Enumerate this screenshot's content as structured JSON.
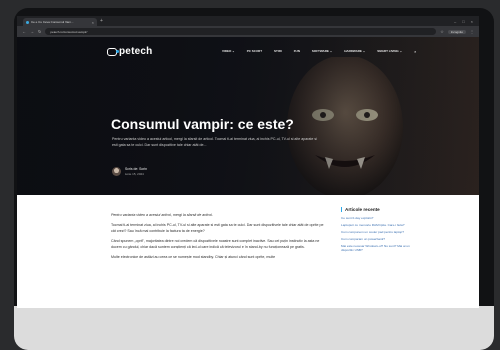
{
  "browser": {
    "tab_title": "Ce e Cu Ceva Consumul Vam...",
    "tab_close": "×",
    "tab_new": "+",
    "url": "petech.ro/consumul-vampir/",
    "profile_label": "Incognito",
    "window_controls": [
      "–",
      "□",
      "×"
    ]
  },
  "site": {
    "logo_text": "petech",
    "menu": [
      "VIDEO ⌄",
      "PC SCURT",
      "STIRI",
      "FUN",
      "SOFTWARE ⌄",
      "HARDWARE ⌄",
      "SMART LIVING ⌄"
    ],
    "accent_color": "#2da8e8"
  },
  "article": {
    "title": "Consumul vampir: ce este?",
    "lead": "Pentru varianta video a acestui articol, mergi la sfarsit de articol. Tocmai ti-ai terminat ziua, ai inchis PC-ul, TV-ul si alte aparate si esti gata sa te culci. Dar sunt dispozitive tale chiar atât de...",
    "author": "Scris de: Sorin",
    "date": "iunie 15, 2024",
    "paragraphs": [
      "Pentru varianta video a acestui articol, mergi la sfarsit de articol.",
      "Tocmai ti-ai terminat ziua, ai inchis PC-ul, TV-ul si alte aparate si esti gata sa te culci. Dar sunt dispozitivele tale chiar atât de oprite pe cât crezi? Sau încă mai contribuie la factura ta de energie?",
      "Când spunem „oprit\", majoritatea dintre noi credem că dispozitivele noastre sunt complet inactive. Sau cel puțin instinctiv la asta ne ducem cu gândul, chiar dacă suntem conștienți că led-ul care indică că televizorul e în stand-by nu funcționează pe gratis.",
      "Multe electronice de astăzi au ceea ce se numește mod standby. Chiar și atunci când sunt oprite, multe"
    ]
  },
  "sidebar": {
    "title": "Articole recente",
    "links": [
      "Ce sunt 0-day exploits?",
      "Laptopuri cu memorie RAM lipita. Care-i faza?",
      "Cum compunem un cooler pad pentru laptop?",
      "Cum comparam un powerbank?",
      "Mai este necesar Windows-ul? Nu sunt? Mai ai un dispozitiv USB?"
    ]
  }
}
